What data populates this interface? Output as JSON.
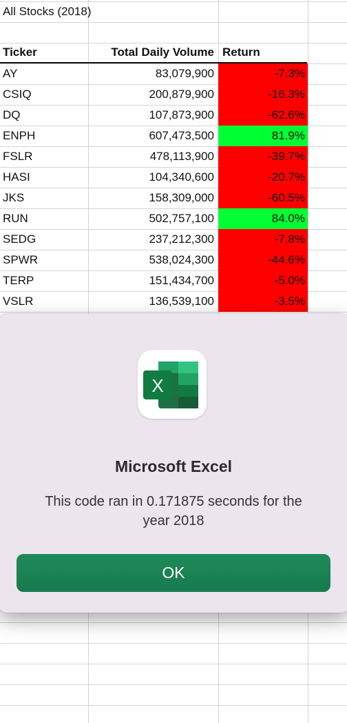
{
  "sheet": {
    "title": "All Stocks (2018)",
    "headers": {
      "ticker": "Ticker",
      "volume": "Total Daily Volume",
      "return": "Return"
    },
    "rows": [
      {
        "ticker": "AY",
        "volume": "83,079,900",
        "return": "-7.3%",
        "status": "negative"
      },
      {
        "ticker": "CSIQ",
        "volume": "200,879,900",
        "return": "-16.3%",
        "status": "negative"
      },
      {
        "ticker": "DQ",
        "volume": "107,873,900",
        "return": "-62.6%",
        "status": "negative"
      },
      {
        "ticker": "ENPH",
        "volume": "607,473,500",
        "return": "81.9%",
        "status": "positive"
      },
      {
        "ticker": "FSLR",
        "volume": "478,113,900",
        "return": "-39.7%",
        "status": "negative"
      },
      {
        "ticker": "HASI",
        "volume": "104,340,600",
        "return": "-20.7%",
        "status": "negative"
      },
      {
        "ticker": "JKS",
        "volume": "158,309,000",
        "return": "-60.5%",
        "status": "negative"
      },
      {
        "ticker": "RUN",
        "volume": "502,757,100",
        "return": "84.0%",
        "status": "positive"
      },
      {
        "ticker": "SEDG",
        "volume": "237,212,300",
        "return": "-7.8%",
        "status": "negative"
      },
      {
        "ticker": "SPWR",
        "volume": "538,024,300",
        "return": "-44.6%",
        "status": "negative"
      },
      {
        "ticker": "TERP",
        "volume": "151,434,700",
        "return": "-5.0%",
        "status": "negative"
      },
      {
        "ticker": "VSLR",
        "volume": "136,539,100",
        "return": "-3.5%",
        "status": "negative"
      }
    ]
  },
  "colors": {
    "negative": "#ff0000",
    "positive": "#00ff33",
    "ok_button": "#1a8050"
  },
  "dialog": {
    "icon": "excel-app-icon",
    "icon_letter": "X",
    "title": "Microsoft Excel",
    "message": "This code ran in 0.171875 seconds for the year 2018",
    "ok_label": "OK"
  }
}
